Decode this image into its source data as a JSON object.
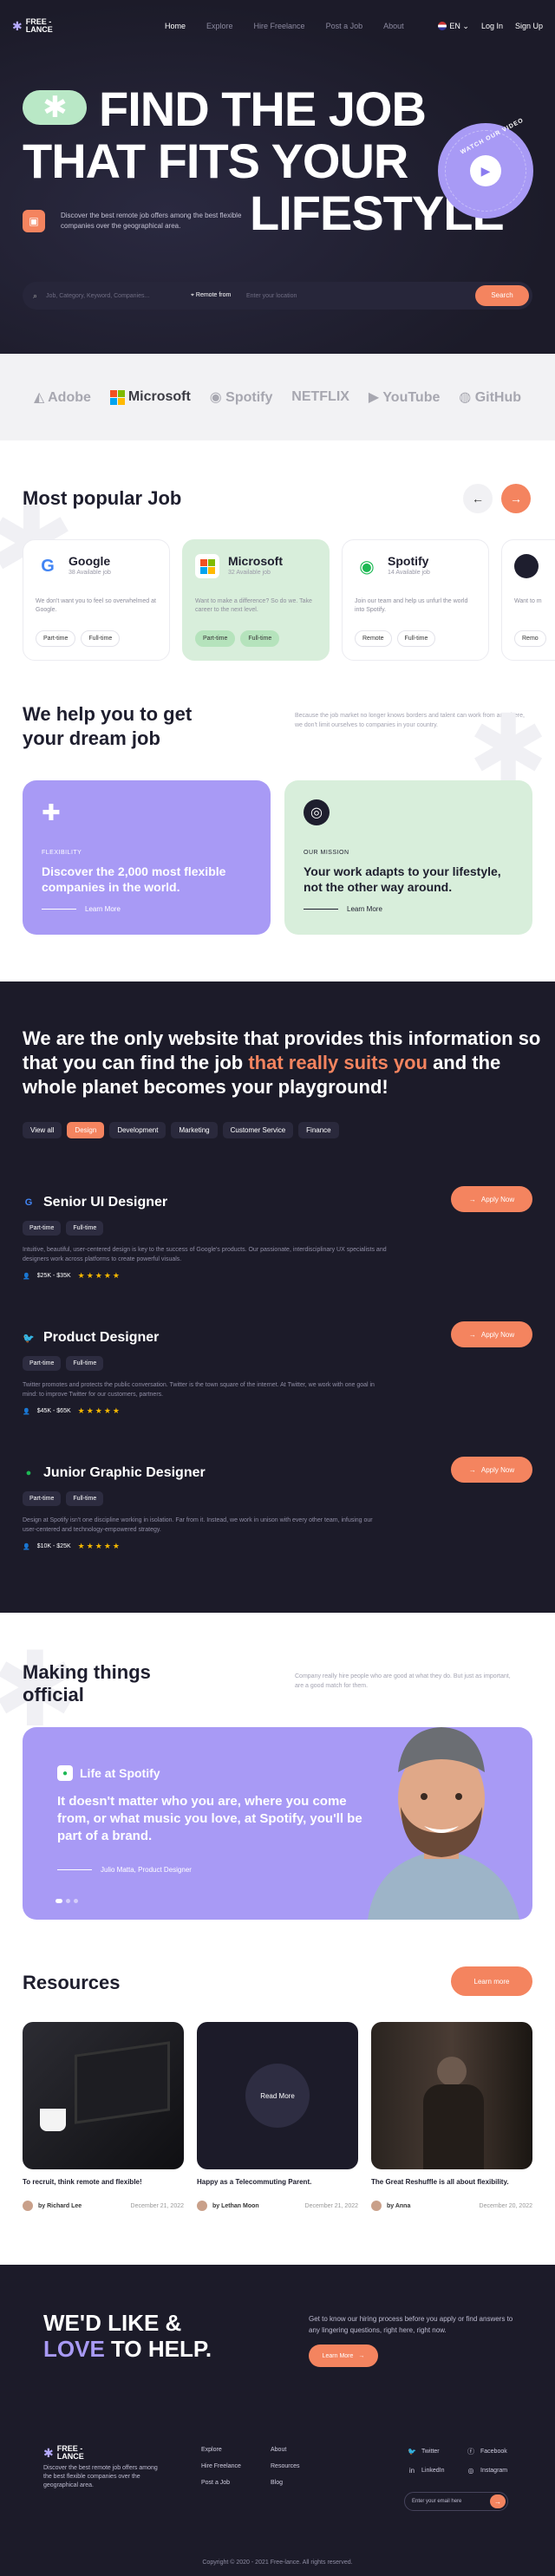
{
  "nav": {
    "logo": [
      "FREE -",
      "LANCE"
    ],
    "links": [
      "Home",
      "Explore",
      "Hire Freelance",
      "Post a Job",
      "About"
    ],
    "lang": "EN",
    "login": "Log In",
    "signup": "Sign Up"
  },
  "hero": {
    "line1": "FIND THE JOB",
    "line2": "THAT FITS YOUR",
    "line3": "LIFESTYLE",
    "watch": "WATCH OUR VIDEO",
    "desc": "Discover the best remote job offers among the best flexible companies over the geographical area.",
    "search_placeholder": "Job, Category, Keyword, Companies...",
    "location_label": "Remote from",
    "location_placeholder": "Enter your location",
    "search_button": "Search"
  },
  "brands": [
    "Adobe",
    "Microsoft",
    "Spotify",
    "NETFLIX",
    "YouTube",
    "GitHub"
  ],
  "popular": {
    "title": "Most popular Job",
    "cards": [
      {
        "name": "Google",
        "available": "38 Available job",
        "desc": "We don't want you to feel so overwhelmed at Google.",
        "tags": [
          "Part-time",
          "Full-time"
        ]
      },
      {
        "name": "Microsoft",
        "available": "32 Available job",
        "desc": "Want to make a difference? So do we. Take career to the next level.",
        "tags": [
          "Part-time",
          "Full-time"
        ]
      },
      {
        "name": "Spotify",
        "available": "14 Available job",
        "desc": "Join our team and help us unfurl the world into Spotify.",
        "tags": [
          "Remote",
          "Full-time"
        ]
      },
      {
        "name": "",
        "available": "",
        "desc": "Want to m",
        "tags": [
          "Remo"
        ]
      }
    ]
  },
  "help": {
    "title": "We help you to get your dream job",
    "desc": "Because the job market no longer knows borders and talent can work from anywhere, we don't limit ourselves to companies in your country.",
    "cards": [
      {
        "label": "FLEXIBILITY",
        "text": "Discover the 2,000 most flexible companies in the world.",
        "link": "Learn More"
      },
      {
        "label": "OUR MISSION",
        "text": "Your work adapts to your lifestyle, not the other way around.",
        "link": "Learn More"
      }
    ]
  },
  "jobs": {
    "headline_a": "We are the only website that provides this information so that you can find the job ",
    "headline_hl": "that really suits you",
    "headline_b": " and the whole planet becomes your playground!",
    "filters": [
      "View all",
      "Design",
      "Development",
      "Marketing",
      "Customer Service",
      "Finance"
    ],
    "apply": "Apply Now",
    "list": [
      {
        "title": "Senior UI Designer",
        "tags": [
          "Part-time",
          "Full-time"
        ],
        "desc": "Intuitive, beautiful, user-centered design is key to the success of Google's products. Our passionate, interdisciplinary UX specialists and designers work across platforms to create powerful visuals.",
        "salary": "$25K - $35K",
        "color": "#4285f4",
        "icon": "G"
      },
      {
        "title": "Product Designer",
        "tags": [
          "Part-time",
          "Full-time"
        ],
        "desc": "Twitter promotes and protects the public conversation. Twitter is the town square of the internet. At Twitter, we work with one goal in mind: to improve Twitter for our customers, partners.",
        "salary": "$45K - $65K",
        "color": "#1da1f2",
        "icon": "🐦"
      },
      {
        "title": "Junior Graphic Designer",
        "tags": [
          "Part-time",
          "Full-time"
        ],
        "desc": "Design at Spotify isn't one discipline working in isolation. Far from it. Instead, we work in unison with every other team, infusing our user-centered and technology-empowered strategy.",
        "salary": "$10K - $25K",
        "color": "#1db954",
        "icon": "●"
      }
    ]
  },
  "official": {
    "title": "Making things official",
    "desc": "Company really hire people who are good at what they do. But just as important, are a good match for them.",
    "company": "Life at Spotify",
    "quote": "It doesn't matter who you are, where you come from, or what music you love, at Spotify, you'll be part of a brand.",
    "author": "Julio Matta, Product Designer"
  },
  "resources": {
    "title": "Resources",
    "learn": "Learn more",
    "read": "Read More",
    "items": [
      {
        "title": "To recruit, think remote and flexible!",
        "author": "by Richard Lee",
        "date": "December 21, 2022"
      },
      {
        "title": "Happy as a Telecommuting Parent.",
        "author": "by Lethan Moon",
        "date": "December 21, 2022"
      },
      {
        "title": "The Great Reshuffle is all about flexibility.",
        "author": "by Anna",
        "date": "December 20, 2022"
      }
    ]
  },
  "footer": {
    "cta1": "WE'D LIKE &",
    "cta_love": "LOVE",
    "cta2": " TO HELP.",
    "text": "Get to know our hiring process before you apply or find answers to any lingering questions, right here, right now.",
    "learn": "Learn More",
    "desc": "Discover the best remote job offers among the best flexible companies over the geographical area.",
    "col1": [
      "Explore",
      "Hire Freelance",
      "Post a Job"
    ],
    "col2": [
      "About",
      "Resources",
      "Blog"
    ],
    "social": [
      "Twitter",
      "Facebook",
      "LinkedIn",
      "Instagram"
    ],
    "email_placeholder": "Enter your email here",
    "copyright": "Copyright © 2020 - 2021 Free-lance. All rights reserved."
  }
}
